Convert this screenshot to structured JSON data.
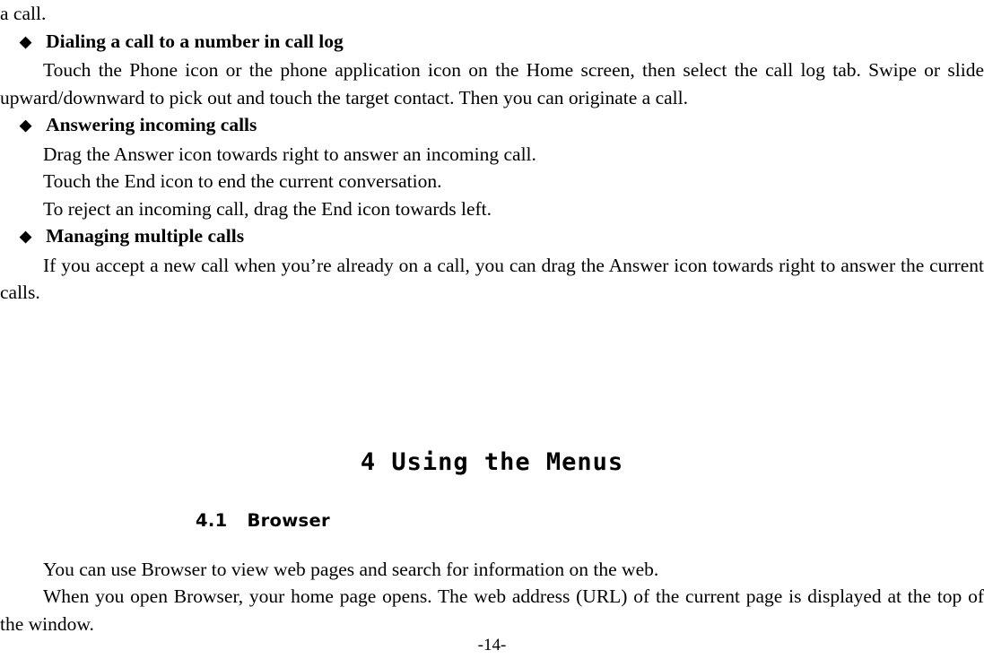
{
  "document": {
    "top_fragment": "a call.",
    "sections": [
      {
        "bullet": "◆",
        "heading": "Dialing a call to a number in call log",
        "paragraphs": [
          "Touch the Phone icon or the phone application icon on the Home screen, then select the call log tab. Swipe or slide upward/downward to pick out and touch the target contact. Then you can originate a call."
        ],
        "lines": []
      },
      {
        "bullet": "◆",
        "heading": "Answering incoming calls",
        "paragraphs": [],
        "lines": [
          "Drag the Answer icon towards right to answer an incoming call.",
          "Touch the End icon to end the current conversation.",
          "To reject an incoming call, drag the End icon towards left."
        ]
      },
      {
        "bullet": "◆",
        "heading": "Managing multiple calls",
        "paragraphs": [
          "If you accept a new call when you’re already on a call, you can drag the Answer icon towards right to answer the current calls."
        ],
        "lines": []
      }
    ],
    "chapter": {
      "title": "4 Using the Menus"
    },
    "subsection": {
      "number": "4.1",
      "title": "Browser"
    },
    "subsection_paragraphs": [
      "You can use Browser to view web pages and search for information on the web.",
      "When you open Browser, your home page opens. The web address (URL) of the current page is displayed at the top of the window."
    ],
    "page_number": "-14-"
  }
}
